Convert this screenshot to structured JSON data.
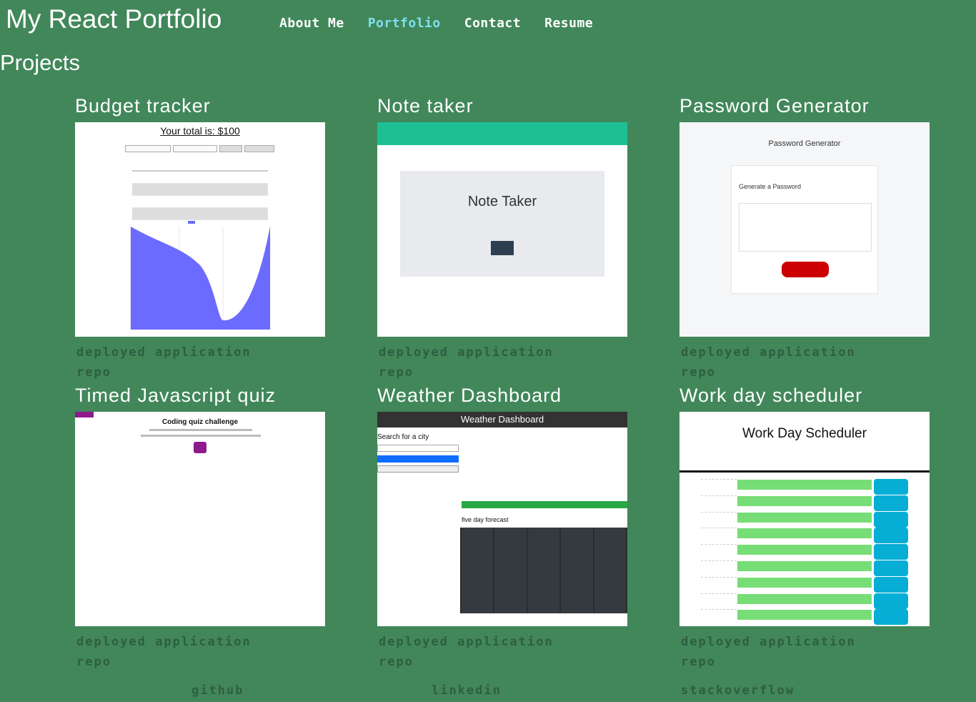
{
  "header": {
    "site_title": "My React Portfolio",
    "nav": [
      {
        "label": "About Me",
        "active": false
      },
      {
        "label": "Portfolio",
        "active": true
      },
      {
        "label": "Contact",
        "active": false
      },
      {
        "label": "Resume",
        "active": false
      }
    ]
  },
  "section_title": "Projects",
  "projects": [
    {
      "title": "Budget tracker",
      "deployed_label": "deployed application",
      "repo_label": "repo",
      "preview": {
        "heading": "Your total is: $100"
      }
    },
    {
      "title": "Note taker",
      "deployed_label": "deployed application",
      "repo_label": "repo",
      "preview": {
        "heading": "Note Taker"
      }
    },
    {
      "title": "Password Generator",
      "deployed_label": "deployed application",
      "repo_label": "repo",
      "preview": {
        "heading": "Password Generator",
        "card_label": "Generate a Password"
      }
    },
    {
      "title": "Timed Javascript quiz",
      "deployed_label": "deployed application",
      "repo_label": "repo",
      "preview": {
        "heading": "Coding quiz challenge"
      }
    },
    {
      "title": "Weather Dashboard",
      "deployed_label": "deployed application",
      "repo_label": "repo",
      "preview": {
        "heading": "Weather Dashboard",
        "search_label": "Search for a city",
        "forecast_label": "five day forecast"
      }
    },
    {
      "title": "Work day scheduler",
      "deployed_label": "deployed application",
      "repo_label": "repo",
      "preview": {
        "heading": "Work Day Scheduler"
      }
    }
  ],
  "footer": {
    "links": [
      "github",
      "linkedin",
      "stackoverflow"
    ]
  },
  "colors": {
    "background": "#41875a",
    "nav_active": "#7fe0ee",
    "link_text": "#2f5e40"
  }
}
